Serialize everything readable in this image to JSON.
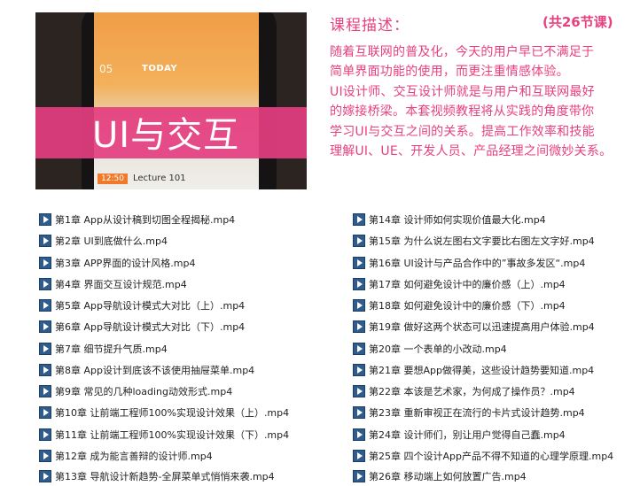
{
  "cover": {
    "date": "05",
    "today": "TODAY",
    "banner": "UI与交互",
    "time": "12:50",
    "lecture": "Lecture 101"
  },
  "description": {
    "title": "课程描述：",
    "count": "(共26节课)",
    "lines": [
      "随着互联网的普及化，今天的用户早已不满足于",
      "简单界面功能的使用，而更注重情感体验。",
      "UI设计师、交互设计师就是与用户和互联网最好",
      "的嫁接桥梁。本套视频教程将从实践的角度带你",
      "学习UI与交互之间的关系。提高工作效率和技能",
      "理解UI、UE、开发人员、产品经理之间微妙关系。"
    ]
  },
  "chapters_left": [
    "第1章 App从设计稿到切图全程揭秘.mp4",
    "第2章 UI到底做什么.mp4",
    "第3章 APP界面的设计风格.mp4",
    "第4章 界面交互设计规范.mp4",
    "第5章 App导航设计模式大对比（上）.mp4",
    "第6章 App导航设计模式大对比（下）.mp4",
    "第7章 细节提升气质.mp4",
    "第8章 App设计到底该不该使用抽屉菜单.mp4",
    "第9章 常见的几种loading动效形式.mp4",
    "第10章 让前端工程师100%实现设计效果（上）.mp4",
    "第11章 让前端工程师100%实现设计效果（下）.mp4",
    "第12章 成为能言善辩的设计师.mp4",
    "第13章 导航设计新趋势-全屏菜单式悄悄来袭.mp4"
  ],
  "chapters_right": [
    "第14章 设计师如何实现价值最大化.mp4",
    "第15章 为什么说左图右文字要比右图左文字好.mp4",
    "第16章 UI设计与产品合作中的”事故多发区“.mp4",
    "第17章 如何避免设计中的廉价感（上）.mp4",
    "第18章 如何避免设计中的廉价感（下）.mp4",
    "第19章 做好这两个状态可以迅速提高用户体验.mp4",
    "第20章 一个表单的小改动.mp4",
    "第21章 要想App做得美，这些设计趋势要知道.mp4",
    "第22章 本该是艺术家，为何成了操作员？.mp4",
    "第23章 重新审视正在流行的卡片式设计趋势.mp4",
    "第24章 设计师们，别让用户觉得自己蠢.mp4",
    "第25章 四个设计App产品不得不知道的心理学原理.mp4",
    "第26章 移动端上如何放置广告.mp4"
  ]
}
